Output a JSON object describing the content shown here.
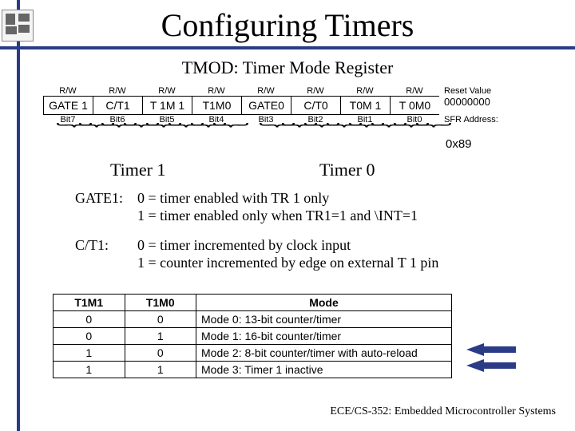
{
  "title": "Configuring Timers",
  "subtitle": "TMOD: Timer Mode Register",
  "register": {
    "rw_row": [
      "R/W",
      "R/W",
      "R/W",
      "R/W",
      "R/W",
      "R/W",
      "R/W",
      "R/W"
    ],
    "reset_label": "Reset Value",
    "names": [
      "GATE 1",
      "C/T1",
      "T 1M 1",
      "T1M0",
      "GATE0",
      "C/T0",
      "T0M 1",
      "T 0M0"
    ],
    "reset_value": "00000000",
    "bits": [
      "Bit7",
      "Bit6",
      "Bit5",
      "Bit4",
      "Bit3",
      "Bit2",
      "Bit1",
      "Bit0"
    ],
    "sfr_label": "SFR Address:",
    "sfr_value": "0x89"
  },
  "brace_labels": {
    "timer1": "Timer 1",
    "timer0": "Timer 0"
  },
  "defs": {
    "gate1_key": "GATE1:",
    "gate1_l1": "0 = timer enabled with TR 1 only",
    "gate1_l2": "1 = timer enabled only when TR1=1 and \\INT=1",
    "ct1_key": "C/T1:",
    "ct1_l1": "0 = timer incremented by clock input",
    "ct1_l2": "1 = counter incremented by edge on external T 1 pin"
  },
  "mode_table": {
    "headers": [
      "T1M1",
      "T1M0",
      "Mode"
    ],
    "rows": [
      {
        "m1": "0",
        "m0": "0",
        "mode": "Mode 0: 13-bit counter/timer"
      },
      {
        "m1": "0",
        "m0": "1",
        "mode": "Mode 1: 16-bit counter/timer"
      },
      {
        "m1": "1",
        "m0": "0",
        "mode": "Mode 2: 8-bit counter/timer with auto-reload"
      },
      {
        "m1": "1",
        "m0": "1",
        "mode": "Mode 3: Timer 1 inactive"
      }
    ]
  },
  "footer": "ECE/CS-352: Embedded Microcontroller Systems"
}
